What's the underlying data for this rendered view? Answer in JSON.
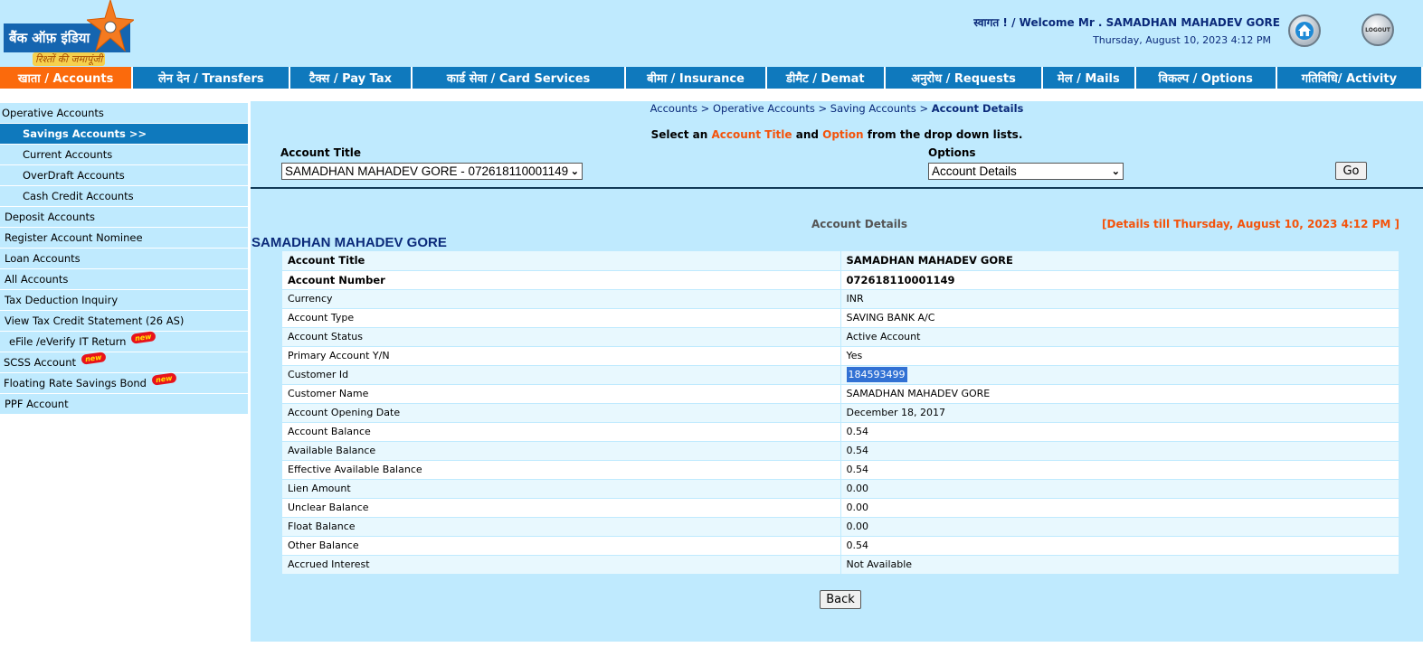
{
  "header": {
    "logo_text": "बैंक ऑफ़ इंडिया",
    "logo_tagline": "रिश्तों की जमापूंजी",
    "welcome": "स्वागत ! / Welcome Mr . SAMADHAN MAHADEV GORE",
    "datetime": "Thursday, August 10, 2023 4:12 PM",
    "logout_label": "LOGOUT"
  },
  "nav": [
    {
      "label": "खाता / Accounts",
      "width": 146
    },
    {
      "label": "लेन देन / Transfers",
      "width": 173
    },
    {
      "label": "टैक्स / Pay Tax",
      "width": 133
    },
    {
      "label": "कार्ड सेवा / Card Services",
      "width": 236
    },
    {
      "label": "बीमा / Insurance",
      "width": 154
    },
    {
      "label": "डीमैट / Demat",
      "width": 130
    },
    {
      "label": "अनुरोध / Requests",
      "width": 173
    },
    {
      "label": "मेल / Mails",
      "width": 101
    },
    {
      "label": "विकल्प / Options",
      "width": 155
    },
    {
      "label": "गतिविधि/ Activity",
      "width": 160
    }
  ],
  "sidebar": [
    "Operative Accounts",
    "Savings Accounts >>",
    "Current Accounts",
    "OverDraft Accounts",
    "Cash Credit Accounts",
    "Deposit Accounts",
    "Register Account Nominee",
    "Loan Accounts",
    "All Accounts",
    "Tax Deduction Inquiry",
    "View Tax Credit Statement (26 AS)",
    "eFile /eVerify IT Return",
    "SCSS Account",
    "Floating Rate Savings Bond",
    "PPF Account"
  ],
  "new_badge": "new",
  "main": {
    "breadcrumb": {
      "path": "Accounts > Operative Accounts > Saving Accounts > ",
      "current": "Account Details"
    },
    "instruction": {
      "p1": "Select an ",
      "h1": "Account Title",
      "p2": " and ",
      "h2": "Option",
      "p3": " from the drop down lists."
    },
    "account_title_label": "Account Title",
    "account_title_value": "SAMADHAN MAHADEV GORE - 072618110001149",
    "options_label": "Options",
    "options_value": "Account Details",
    "go_label": "Go",
    "section_title": "Account Details",
    "details_till": "[Details till Thursday, August 10, 2023 4:12 PM ]",
    "customer_name_heading": "SAMADHAN MAHADEV GORE",
    "back_label": "Back"
  },
  "details": [
    {
      "label": "Account Title",
      "value": "SAMADHAN MAHADEV GORE"
    },
    {
      "label": "Account Number",
      "value": "072618110001149"
    },
    {
      "label": "Currency",
      "value": "INR"
    },
    {
      "label": "Account Type",
      "value": "SAVING BANK A/C"
    },
    {
      "label": "Account Status",
      "value": "Active Account"
    },
    {
      "label": "Primary Account Y/N",
      "value": "Yes"
    },
    {
      "label": "Customer Id",
      "value": "184593499"
    },
    {
      "label": "Customer Name",
      "value": "SAMADHAN MAHADEV GORE"
    },
    {
      "label": "Account Opening Date",
      "value": "December 18, 2017"
    },
    {
      "label": "Account Balance",
      "value": "0.54"
    },
    {
      "label": "Available Balance",
      "value": "0.54"
    },
    {
      "label": "Effective Available Balance",
      "value": "0.54"
    },
    {
      "label": "Lien Amount",
      "value": "0.00"
    },
    {
      "label": "Unclear Balance",
      "value": "0.00"
    },
    {
      "label": "Float Balance",
      "value": "0.00"
    },
    {
      "label": "Other Balance",
      "value": "0.54"
    },
    {
      "label": "Accrued Interest",
      "value": "Not Available"
    }
  ]
}
